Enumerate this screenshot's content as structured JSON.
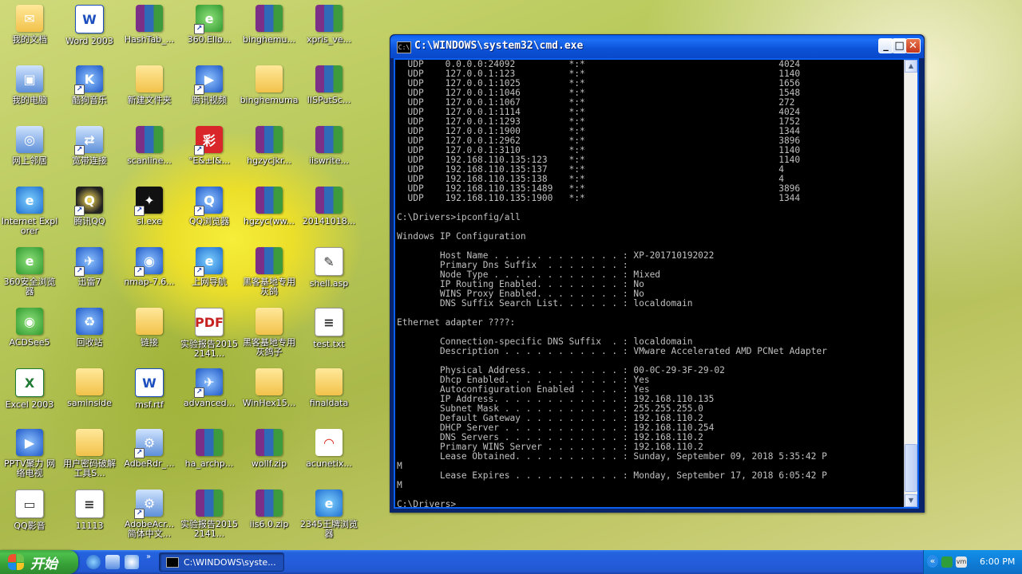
{
  "desktop": {
    "icons": [
      {
        "id": "my-documents",
        "label": "我的文档",
        "glyph": "✉"
      },
      {
        "id": "word-2003",
        "label": "Word 2003",
        "glyph": "W"
      },
      {
        "id": "hashtab",
        "label": "HashTab_...",
        "glyph": ""
      },
      {
        "id": "browser-360",
        "label": "360.Ellø...",
        "glyph": "e"
      },
      {
        "id": "binghemu-1",
        "label": "binghemu...",
        "glyph": ""
      },
      {
        "id": "xpris",
        "label": "xpris_ve...",
        "glyph": ""
      },
      {
        "id": "my-computer",
        "label": "我的电脑",
        "glyph": "▣"
      },
      {
        "id": "kugou-music",
        "label": "酷狗音乐",
        "glyph": "K"
      },
      {
        "id": "new-folder",
        "label": "新建文件夹",
        "glyph": ""
      },
      {
        "id": "tencent-video",
        "label": "腾讯视频",
        "glyph": "▶"
      },
      {
        "id": "binghemuma",
        "label": "binghemuma",
        "glyph": ""
      },
      {
        "id": "iisputsc",
        "label": "IISPutSc...",
        "glyph": ""
      },
      {
        "id": "network-places",
        "label": "网上邻居",
        "glyph": "◎"
      },
      {
        "id": "broadband",
        "label": "宽带连接",
        "glyph": "⇄"
      },
      {
        "id": "scanline",
        "label": "scanline...",
        "glyph": ""
      },
      {
        "id": "lottery",
        "label": "°E&±l&...",
        "glyph": "彩"
      },
      {
        "id": "hgzycjkr",
        "label": "hgzycjkr...",
        "glyph": ""
      },
      {
        "id": "iiswrite",
        "label": "iiswrite...",
        "glyph": ""
      },
      {
        "id": "internet-explorer",
        "label": "Internet Explorer",
        "glyph": "e"
      },
      {
        "id": "tencent-qq",
        "label": "腾讯QQ",
        "glyph": "Q"
      },
      {
        "id": "sl-exe",
        "label": "sl.exe",
        "glyph": "✦"
      },
      {
        "id": "qq-browser",
        "label": "QQ浏览器",
        "glyph": "Q"
      },
      {
        "id": "hgzycww",
        "label": "hgzyc(ww...",
        "glyph": ""
      },
      {
        "id": "file-20141018",
        "label": "20141018...",
        "glyph": ""
      },
      {
        "id": "secure-browser-360",
        "label": "360安全浏览器",
        "glyph": "e"
      },
      {
        "id": "xunlei-7",
        "label": "迅雷7",
        "glyph": "✈"
      },
      {
        "id": "nmap",
        "label": "nmap-7.6...",
        "glyph": "◉"
      },
      {
        "id": "web-nav",
        "label": "上网导航",
        "glyph": "e"
      },
      {
        "id": "hacker-base-1",
        "label": "黑客基地专用灰鸽",
        "glyph": ""
      },
      {
        "id": "shell-asp",
        "label": "shell.asp",
        "glyph": "✎"
      },
      {
        "id": "acdsee5",
        "label": "ACDSee5",
        "glyph": "◉"
      },
      {
        "id": "recycle-bin",
        "label": "回收站",
        "glyph": "♻"
      },
      {
        "id": "links-folder",
        "label": "链接",
        "glyph": ""
      },
      {
        "id": "lab-report-pdf",
        "label": "实验报告20152141...",
        "glyph": "PDF"
      },
      {
        "id": "hacker-base-2",
        "label": "黑客基地专用灰鸽子",
        "glyph": ""
      },
      {
        "id": "test-txt",
        "label": "test.txt",
        "glyph": "≡"
      },
      {
        "id": "excel-2003",
        "label": "Excel 2003",
        "glyph": "X"
      },
      {
        "id": "saminside",
        "label": "saminside",
        "glyph": ""
      },
      {
        "id": "msf-rtf",
        "label": "msf.rtf",
        "glyph": "W"
      },
      {
        "id": "advanced",
        "label": "advanced...",
        "glyph": "✈"
      },
      {
        "id": "winhex",
        "label": "WinHex15...",
        "glyph": ""
      },
      {
        "id": "finaldata",
        "label": "finaldata",
        "glyph": ""
      },
      {
        "id": "pptv",
        "label": "PPTV聚力 网络电视",
        "glyph": "▶"
      },
      {
        "id": "password-tool",
        "label": "用户密码破解工具S...",
        "glyph": ""
      },
      {
        "id": "adberdr",
        "label": "AdbeRdr_...",
        "glyph": "⚙"
      },
      {
        "id": "ha-archp",
        "label": "ha_archp...",
        "glyph": ""
      },
      {
        "id": "wollf-zip",
        "label": "wollf.zip",
        "glyph": ""
      },
      {
        "id": "acunetix",
        "label": "acunetix...",
        "glyph": "◠"
      },
      {
        "id": "qq-player",
        "label": "QQ影音",
        "glyph": "▭"
      },
      {
        "id": "file-11113",
        "label": "11113",
        "glyph": "≡"
      },
      {
        "id": "adobe-acrobat",
        "label": "AdobeAcr... 简体中文...",
        "glyph": "⚙"
      },
      {
        "id": "lab-report-rar",
        "label": "实验报告20152141...",
        "glyph": ""
      },
      {
        "id": "iis6-zip",
        "label": "iis6.0.zip",
        "glyph": ""
      },
      {
        "id": "browser-2345",
        "label": "2345王牌浏览器",
        "glyph": "e"
      }
    ]
  },
  "cmd": {
    "title": "C:\\WINDOWS\\system32\\cmd.exe",
    "title_icon": "C:\\",
    "output": "  UDP    0.0.0.0:24092          *:*                                    4024\n  UDP    127.0.0.1:123          *:*                                    1140\n  UDP    127.0.0.1:1025         *:*                                    1656\n  UDP    127.0.0.1:1046         *:*                                    1548\n  UDP    127.0.0.1:1067         *:*                                    272\n  UDP    127.0.0.1:1114         *:*                                    4024\n  UDP    127.0.0.1:1293         *:*                                    1752\n  UDP    127.0.0.1:1900         *:*                                    1344\n  UDP    127.0.0.1:2962         *:*                                    3896\n  UDP    127.0.0.1:3110         *:*                                    1140\n  UDP    192.168.110.135:123    *:*                                    1140\n  UDP    192.168.110.135:137    *:*                                    4\n  UDP    192.168.110.135:138    *:*                                    4\n  UDP    192.168.110.135:1489   *:*                                    3896\n  UDP    192.168.110.135:1900   *:*                                    1344\n\nC:\\Drivers>ipconfig/all\n\nWindows IP Configuration\n\n        Host Name . . . . . . . . . . . . : XP-201710192022\n        Primary Dns Suffix  . . . . . . . : \n        Node Type . . . . . . . . . . . . : Mixed\n        IP Routing Enabled. . . . . . . . : No\n        WINS Proxy Enabled. . . . . . . . : No\n        DNS Suffix Search List. . . . . . : localdomain\n\nEthernet adapter ????:\n\n        Connection-specific DNS Suffix  . : localdomain\n        Description . . . . . . . . . . . : VMware Accelerated AMD PCNet Adapter\n\n        Physical Address. . . . . . . . . : 00-0C-29-3F-29-02\n        Dhcp Enabled. . . . . . . . . . . : Yes\n        Autoconfiguration Enabled . . . . : Yes\n        IP Address. . . . . . . . . . . . : 192.168.110.135\n        Subnet Mask . . . . . . . . . . . : 255.255.255.0\n        Default Gateway . . . . . . . . . : 192.168.110.2\n        DHCP Server . . . . . . . . . . . : 192.168.110.254\n        DNS Servers . . . . . . . . . . . : 192.168.110.2\n        Primary WINS Server . . . . . . . : 192.168.110.2\n        Lease Obtained. . . . . . . . . . : Sunday, September 09, 2018 5:35:42 P\nM\n        Lease Expires . . . . . . . . . . : Monday, September 17, 2018 6:05:42 P\nM\n\nC:\\Drivers>_",
    "buttons": {
      "minimize": "_",
      "maximize": "□",
      "close": "✕"
    },
    "scroll": {
      "up": "▲",
      "down": "▼"
    }
  },
  "taskbar": {
    "start_label": "开始",
    "task_label": "C:\\WINDOWS\\syste...",
    "clock": "6:00 PM",
    "tray_vm_label": "vm",
    "tray_arrow": "«"
  }
}
